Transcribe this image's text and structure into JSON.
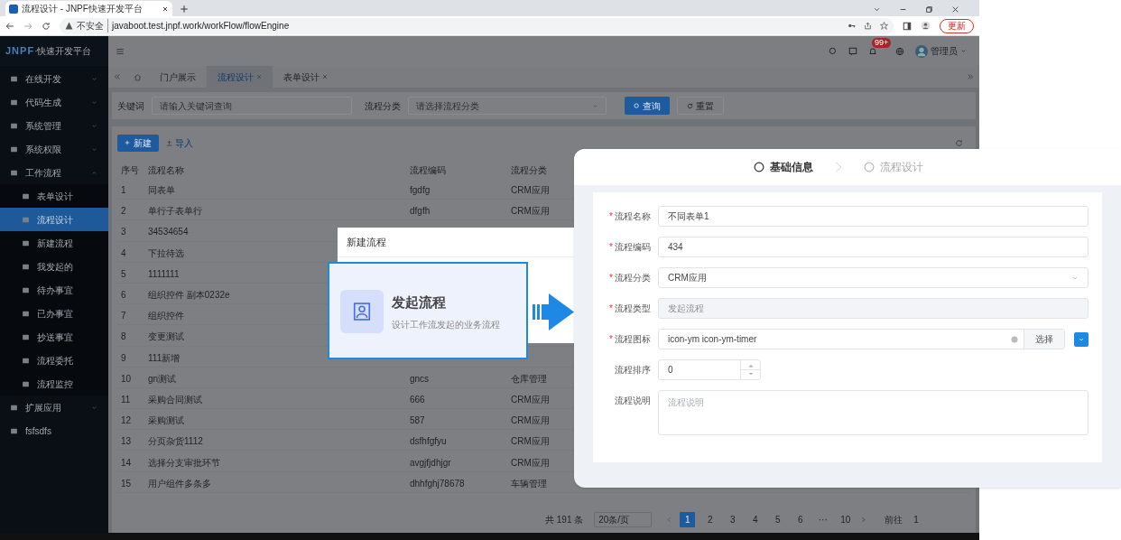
{
  "browser": {
    "tab_title": "流程设计 - JNPF快速开发平台",
    "security": "不安全",
    "url": "javaboot.test.jnpf.work/workFlow/flowEngine",
    "update_button": "更新"
  },
  "header": {
    "logo_mark": "JNPF",
    "logo_text": "·快速开发平台",
    "badge": "99+",
    "user": "管理员"
  },
  "sidebar": [
    {
      "label": "在线开发",
      "kind": "group",
      "expanded": false,
      "selected": false
    },
    {
      "label": "代码生成",
      "kind": "group",
      "expanded": false,
      "selected": false
    },
    {
      "label": "系统管理",
      "kind": "group",
      "expanded": false,
      "selected": false
    },
    {
      "label": "系统权限",
      "kind": "group",
      "expanded": false,
      "selected": false
    },
    {
      "label": "工作流程",
      "kind": "group",
      "expanded": true,
      "selected": false,
      "children": [
        {
          "label": "表单设计",
          "selected": false
        },
        {
          "label": "流程设计",
          "selected": true
        },
        {
          "label": "新建流程",
          "selected": false
        },
        {
          "label": "我发起的",
          "selected": false
        },
        {
          "label": "待办事宜",
          "selected": false
        },
        {
          "label": "已办事宜",
          "selected": false
        },
        {
          "label": "抄送事宜",
          "selected": false
        },
        {
          "label": "流程委托",
          "selected": false
        },
        {
          "label": "流程监控",
          "selected": false
        }
      ]
    },
    {
      "label": "扩展应用",
      "kind": "group",
      "expanded": false,
      "selected": false
    },
    {
      "label": "fsfsdfs",
      "kind": "page",
      "selected": false
    }
  ],
  "tabs": [
    {
      "label": "门户展示",
      "selected": false,
      "closable": false
    },
    {
      "label": "流程设计",
      "selected": true,
      "closable": true
    },
    {
      "label": "表单设计",
      "selected": false,
      "closable": true
    }
  ],
  "search": {
    "fields": [
      {
        "label": "关键词",
        "kind": "input",
        "placeholder": "请输入关键词查询"
      },
      {
        "label": "流程分类",
        "kind": "select",
        "placeholder": "请选择流程分类"
      }
    ],
    "buttons": [
      {
        "label": "查询",
        "kind": "primary"
      },
      {
        "label": "重置",
        "kind": "default"
      }
    ]
  },
  "toolbar": {
    "new_button": "新建",
    "import_link": "导入"
  },
  "table": {
    "columns": [
      "序号",
      "流程名称",
      "流程编码",
      "流程分类"
    ],
    "rows": [
      {
        "index": "1",
        "name": "同表单",
        "code": "fgdfg",
        "category": "CRM应用"
      },
      {
        "index": "2",
        "name": "单行子表单行",
        "code": "dfgfh",
        "category": "CRM应用"
      },
      {
        "index": "3",
        "name": "34534654"
      },
      {
        "index": "4",
        "name": "下拉待选"
      },
      {
        "index": "5",
        "name": "1111111"
      },
      {
        "index": "6",
        "name": "组织控件 副本0232e"
      },
      {
        "index": "7",
        "name": "组织控件"
      },
      {
        "index": "8",
        "name": "变更测试"
      },
      {
        "index": "9",
        "name": "111新增"
      },
      {
        "index": "10",
        "name": "gn测试",
        "code": "gncs",
        "category": "仓库管理"
      },
      {
        "index": "11",
        "name": "采购合同测试",
        "code": "666",
        "category": "CRM应用"
      },
      {
        "index": "12",
        "name": "采购测试",
        "code": "587",
        "category": "CRM应用"
      },
      {
        "index": "13",
        "name": "分页杂货1112",
        "code": "dsfhfgfyu",
        "category": "CRM应用"
      },
      {
        "index": "14",
        "name": "选择分支审批环节",
        "code": "avgjfjdhjgr",
        "category": "CRM应用"
      },
      {
        "index": "15",
        "name": "用户组件多条多",
        "code": "dhhfghj78678",
        "category": "车辆管理"
      }
    ]
  },
  "pagination": {
    "total": "共 191 条",
    "page_size": "20条/页",
    "pages": [
      {
        "label": "1",
        "selected": true
      },
      {
        "label": "2",
        "selected": false
      },
      {
        "label": "3",
        "selected": false
      },
      {
        "label": "4",
        "selected": false
      },
      {
        "label": "5",
        "selected": false
      },
      {
        "label": "6",
        "selected": false
      },
      {
        "label": "···",
        "selected": false
      },
      {
        "label": "10",
        "selected": false
      }
    ],
    "goto_label": "前往",
    "goto_value": "1"
  },
  "dialog": {
    "title": "新建流程"
  },
  "card": {
    "title": "发起流程",
    "description": "设计工作流发起的业务流程"
  },
  "form": {
    "steps": [
      {
        "label": "基础信息",
        "active": true
      },
      {
        "label": "流程设计",
        "active": false
      }
    ],
    "fields": [
      {
        "label": "流程名称",
        "required_mark": "*",
        "kind": "input",
        "value": "不同表单1"
      },
      {
        "label": "流程编码",
        "required_mark": "*",
        "kind": "input",
        "value": "434"
      },
      {
        "label": "流程分类",
        "required_mark": "*",
        "kind": "select",
        "value": "CRM应用"
      },
      {
        "label": "流程类型",
        "required_mark": "*",
        "kind": "disabled",
        "value": "发起流程"
      },
      {
        "label": "流程图标",
        "required_mark": "*",
        "kind": "icon",
        "value": "icon-ym icon-ym-timer",
        "button": "选择"
      },
      {
        "label": "流程排序",
        "kind": "number",
        "value": "0"
      },
      {
        "label": "流程说明",
        "kind": "textarea",
        "placeholder": "流程说明"
      }
    ]
  }
}
